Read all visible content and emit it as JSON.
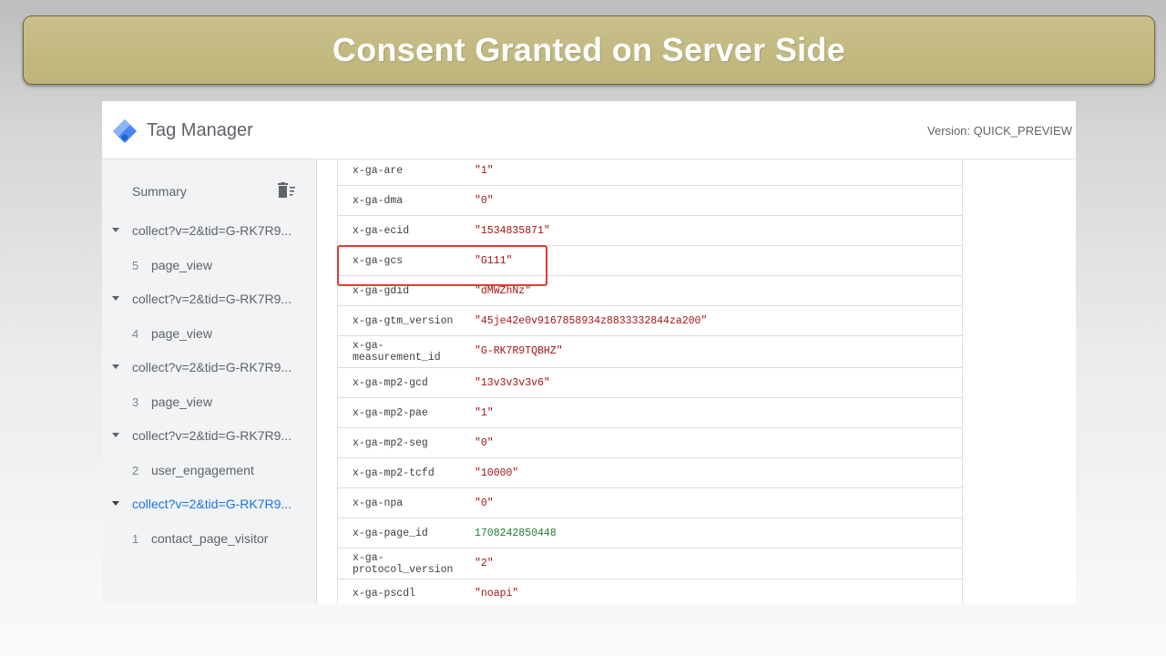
{
  "slide": {
    "title": "Consent Granted on Server Side"
  },
  "header": {
    "app_name": "Tag Manager",
    "version": "Version: QUICK_PREVIEW"
  },
  "icons": {
    "logo": "tag-manager-logo",
    "trash": "delete-all-icon"
  },
  "sidebar": {
    "summary_label": "Summary",
    "requests": [
      {
        "label": "collect?v=2&tid=G-RK7R9...",
        "event_number": "5",
        "event_name": "page_view"
      },
      {
        "label": "collect?v=2&tid=G-RK7R9...",
        "event_number": "4",
        "event_name": "page_view"
      },
      {
        "label": "collect?v=2&tid=G-RK7R9...",
        "event_number": "3",
        "event_name": "page_view"
      },
      {
        "label": "collect?v=2&tid=G-RK7R9...",
        "event_number": "2",
        "event_name": "user_engagement"
      },
      {
        "label": "collect?v=2&tid=G-RK7R9...",
        "event_number": "1",
        "event_name": "contact_page_visitor"
      }
    ]
  },
  "table": {
    "rows": [
      {
        "key": "x-ga-are",
        "value": "\"1\""
      },
      {
        "key": "x-ga-dma",
        "value": "\"0\""
      },
      {
        "key": "x-ga-ecid",
        "value": "\"1534835871\""
      },
      {
        "key": "x-ga-gcs",
        "value": "\"G111\""
      },
      {
        "key": "x-ga-gdid",
        "value": "\"dMWZhNz\""
      },
      {
        "key": "x-ga-gtm_version",
        "value": "\"45je42e0v9167858934z8833332844za200\""
      },
      {
        "key": "x-ga-measurement_id",
        "value": "\"G-RK7R9TQBHZ\""
      },
      {
        "key": "x-ga-mp2-gcd",
        "value": "\"13v3v3v3v6\""
      },
      {
        "key": "x-ga-mp2-pae",
        "value": "\"1\""
      },
      {
        "key": "x-ga-mp2-seg",
        "value": "\"0\""
      },
      {
        "key": "x-ga-mp2-tcfd",
        "value": "\"10000\""
      },
      {
        "key": "x-ga-npa",
        "value": "\"0\""
      },
      {
        "key": "x-ga-page_id",
        "value": "1708242850448"
      },
      {
        "key": "x-ga-protocol_version",
        "value": "\"2\""
      },
      {
        "key": "x-ga-pscdl",
        "value": "\"noapi\""
      }
    ]
  },
  "colors": {
    "banner": "#c2b97f",
    "accent_blue": "#1a73e8",
    "string_value": "#a31515",
    "number_value": "#1e7e34",
    "highlight": "#e53935"
  }
}
